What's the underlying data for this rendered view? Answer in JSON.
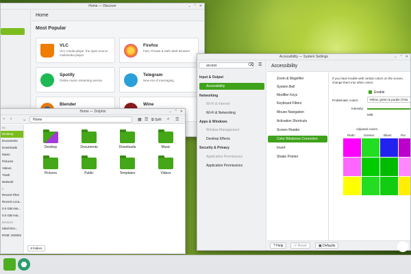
{
  "discover": {
    "title": "Home — Discover",
    "header": "Home",
    "section": "Most Popular",
    "apps": [
      {
        "name": "VLC",
        "desc": "VLC media player, the open-source multimedia player",
        "color": "#f07c00"
      },
      {
        "name": "Firefox",
        "desc": "Fast, Private & Safe Web Browser",
        "color": "#b13dd8"
      },
      {
        "name": "Spotify",
        "desc": "Online music streaming service",
        "color": "#1db954"
      },
      {
        "name": "Telegram",
        "desc": "New era of messaging",
        "color": "#2aa0d9"
      },
      {
        "name": "Blender",
        "desc": "Free and open source 3D",
        "color": "#e87d0d"
      },
      {
        "name": "Wine",
        "desc": "Run Windows applications",
        "color": "#8a1b1b"
      }
    ]
  },
  "dolphin": {
    "title": "Home — Dolphin",
    "location": "Home",
    "split": "Split",
    "status": "8 folders",
    "places": [
      "es",
      "",
      "Desktop",
      "Documents",
      "Downloads",
      "Music",
      "Pictures",
      "Videos",
      "Trash",
      "",
      "Network",
      "s",
      "Recent Files",
      "Recent Loca...",
      "",
      "0.0 GiB Inte...",
      "0.0 GiB Har...",
      "",
      "Devices",
      "Ideal Dev...",
      "ROM: 202502"
    ],
    "files": [
      "Desktop",
      "Documents",
      "Downloads",
      "Music",
      "Pictures",
      "Public",
      "Templates",
      "Videos"
    ]
  },
  "settings": {
    "title": "Accessibility — System Settings",
    "search": "access",
    "header": "Accessibility",
    "cats": [
      {
        "label": "Input & Output",
        "items": [
          {
            "label": "Accessibility",
            "active": true
          }
        ]
      },
      {
        "label": "Networking",
        "items": [
          {
            "label": "Wi-Fi & Internet",
            "dim": true
          },
          {
            "label": "Wi-Fi & Networking"
          }
        ]
      },
      {
        "label": "Apps & Windows",
        "items": [
          {
            "label": "Window Management",
            "dim": true
          },
          {
            "label": "Desktop Effects"
          }
        ]
      },
      {
        "label": "Security & Privacy",
        "items": [
          {
            "label": "Application Permissions",
            "dim": true
          },
          {
            "label": "Application Permissions"
          }
        ]
      }
    ],
    "modules": [
      "Zoom & Magnifier",
      "System Bell",
      "Modifier Keys",
      "Keyboard Filters",
      "Mouse Navigation",
      "Activation Shortcuts",
      "Screen Reader",
      "Color Blindness Correction",
      "Invert",
      "Shake Pointer"
    ],
    "desc": "If you have trouble with certain colors on the screen, change them into other colors.",
    "enable": "Enable",
    "problematic_label": "Problematic colors:",
    "problematic_value": "Yellow, green & purple (Trita",
    "intensity_label": "Intensity:",
    "mild": "Mild",
    "adjusted": "Adjusted colors:",
    "channels": [
      "Reds:",
      "Greens:",
      "Blues:",
      "Pur"
    ],
    "footer": {
      "help": "Help",
      "reset": "Reset",
      "defaults": "Defaults"
    }
  }
}
